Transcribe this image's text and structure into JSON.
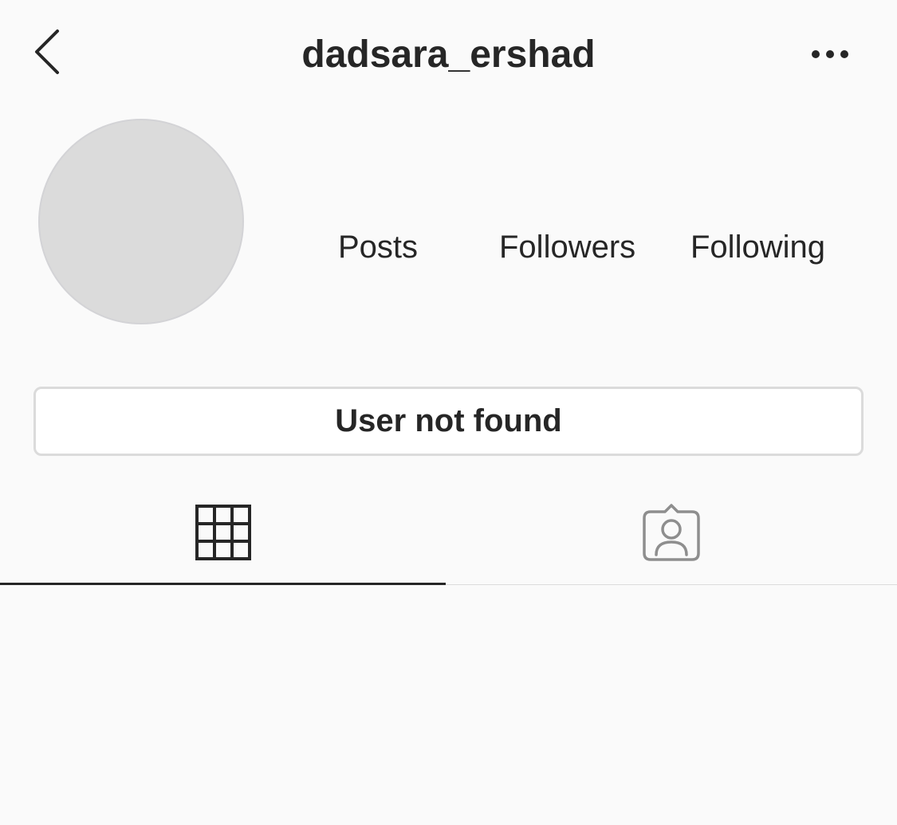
{
  "header": {
    "username": "dadsara_ershad",
    "back_icon": "chevron-left-icon",
    "more_icon": "more-horizontal-icon"
  },
  "profile": {
    "stats": {
      "posts_label": "Posts",
      "followers_label": "Followers",
      "following_label": "Following"
    }
  },
  "status_button": {
    "label": "User not found"
  },
  "tabs": [
    {
      "name": "grid",
      "icon": "grid-icon",
      "active": true
    },
    {
      "name": "tagged",
      "icon": "tagged-person-icon",
      "active": false
    }
  ],
  "colors": {
    "background": "#fafafa",
    "text": "#262626",
    "border": "#dbdbdb",
    "avatar_placeholder": "#dbdbdb",
    "inactive_icon": "#8e8e8e"
  }
}
